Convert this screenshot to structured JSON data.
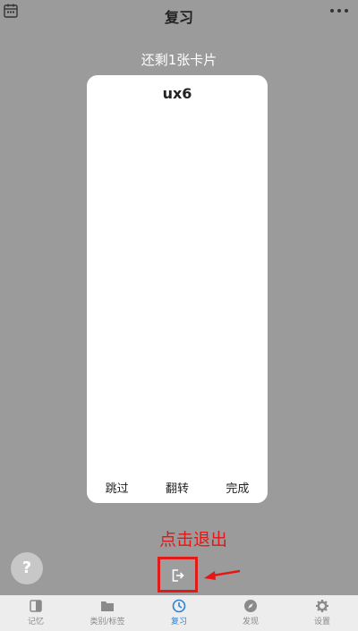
{
  "header": {
    "title": "复习"
  },
  "review": {
    "remaining": "还剩1张卡片"
  },
  "card": {
    "term": "ux6",
    "actions": {
      "skip": "跳过",
      "flip": "翻转",
      "done": "完成"
    }
  },
  "annotation": {
    "text": "点击退出"
  },
  "help": {
    "label": "?"
  },
  "tabs": [
    {
      "label": "记忆",
      "icon": "book-icon"
    },
    {
      "label": "类别/标签",
      "icon": "folder-icon"
    },
    {
      "label": "复习",
      "icon": "clock-icon"
    },
    {
      "label": "发现",
      "icon": "compass-icon"
    },
    {
      "label": "设置",
      "icon": "gear-icon"
    }
  ],
  "colors": {
    "accent": "#2b82d9",
    "annotation": "#e41616",
    "background": "#9b9b9b"
  }
}
